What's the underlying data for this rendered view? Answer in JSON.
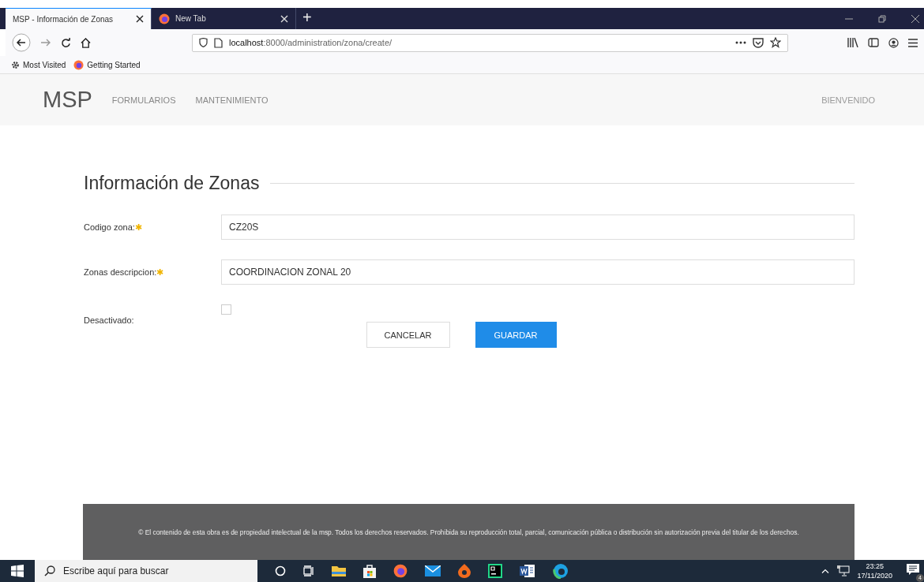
{
  "browser": {
    "tabs": [
      {
        "title": "MSP - Información de Zonas",
        "selected": true
      },
      {
        "title": "New Tab",
        "selected": false
      }
    ],
    "new_tab": "+",
    "url": {
      "host": "localhost",
      "path": ":8000/administration/zona/create/"
    },
    "bookmarks": [
      "Most Visited",
      "Getting Started"
    ]
  },
  "navbar": {
    "brand": "MSP",
    "links": [
      "FORMULARIOS",
      "MANTENIMIENTO"
    ],
    "right": "BIENVENIDO"
  },
  "form": {
    "title": "Información de Zonas",
    "fields": [
      {
        "kind": "text",
        "label": "Codigo zona:",
        "mark": "✱",
        "value": "CZ20S"
      },
      {
        "kind": "text",
        "label": "Zonas descripcion:",
        "mark": "✱",
        "value": "COORDINACION ZONAL 20"
      },
      {
        "kind": "checkbox",
        "label": "Desactivado:",
        "checked": false
      }
    ],
    "buttons": [
      {
        "label": "CANCELAR",
        "kind": "secondary"
      },
      {
        "label": "GUARDAR",
        "kind": "primary"
      }
    ]
  },
  "footer": "© El contenido de esta obra es de propiedad intelectual de la msp. Todos los derechos reservados. Prohibida su reproducción total, parcial, comunicación pública o distribución sin autorización previa del titular de los derechos.",
  "taskbar": {
    "search": {
      "placeholder": "Escribe aquí para buscar"
    },
    "time": "23:25",
    "date": "17/11/2020",
    "notifications": "4"
  }
}
